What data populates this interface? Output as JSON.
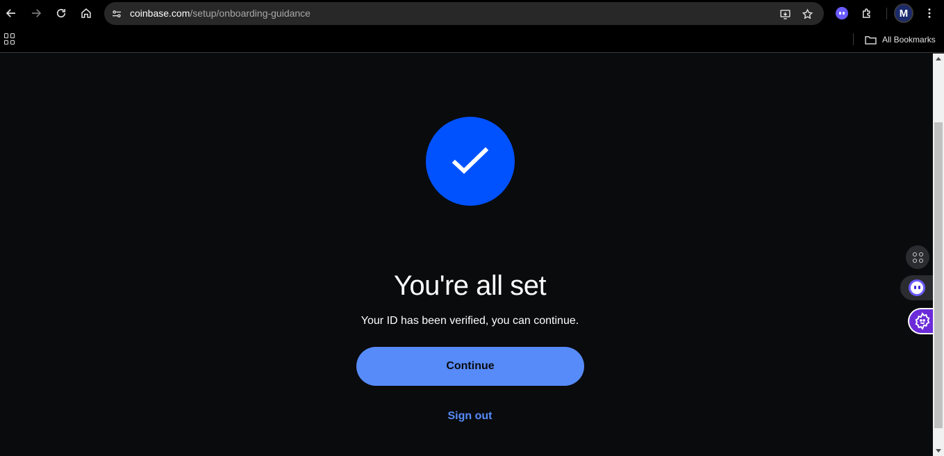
{
  "browser": {
    "url_host": "coinbase.com",
    "url_path": "/setup/onboarding-guidance",
    "profile_initial": "M",
    "bookmarks_label": "All Bookmarks"
  },
  "page": {
    "title": "You're all set",
    "subtitle": "Your ID has been verified, you can continue.",
    "continue_label": "Continue",
    "signout_label": "Sign out"
  },
  "colors": {
    "background": "#0a0b0d",
    "brand_blue": "#0052ff",
    "button_blue": "#578bfa"
  }
}
